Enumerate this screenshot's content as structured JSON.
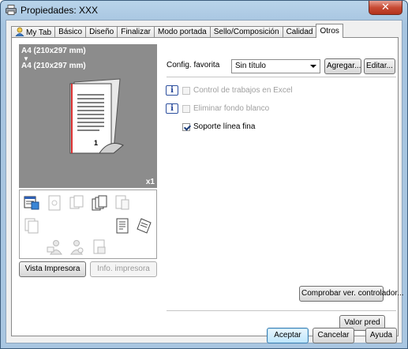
{
  "window": {
    "title": "Propiedades: XXX",
    "close_glyph": "✕"
  },
  "tabs": [
    {
      "label": "My Tab",
      "icon": "user-icon"
    },
    {
      "label": "Básico"
    },
    {
      "label": "Diseño"
    },
    {
      "label": "Finalizar"
    },
    {
      "label": "Modo portada"
    },
    {
      "label": "Sello/Composición"
    },
    {
      "label": "Calidad"
    },
    {
      "label": "Otros",
      "active": true
    }
  ],
  "preview": {
    "paper_line_1": "A4 (210x297 mm)",
    "arrow": "▼",
    "paper_line_2": "A4 (210x297 mm)",
    "copies": "x1",
    "page_number": "1"
  },
  "left_buttons": {
    "printer_view": "Vista Impresora",
    "printer_info": "Info. impresora"
  },
  "favorites": {
    "label": "Config. favorita",
    "selected": "Sin título",
    "add_button": "Agregar...",
    "edit_button": "Editar..."
  },
  "options": [
    {
      "label": "Control de trabajos en Excel",
      "checked": false,
      "enabled": false
    },
    {
      "label": "Eliminar fondo blanco",
      "checked": false,
      "enabled": false
    },
    {
      "label": "Soporte línea fina",
      "checked": true,
      "enabled": true
    }
  ],
  "check_driver_button": "Comprobar ver. controlador...",
  "default_button": "Valor pred",
  "dialog_buttons": {
    "ok": "Aceptar",
    "cancel": "Cancelar",
    "help": "Ayuda"
  },
  "colors": {
    "title_bg": "#a6c4e0",
    "preview_bg": "#8c8c8c",
    "close_red": "#c74b35"
  }
}
